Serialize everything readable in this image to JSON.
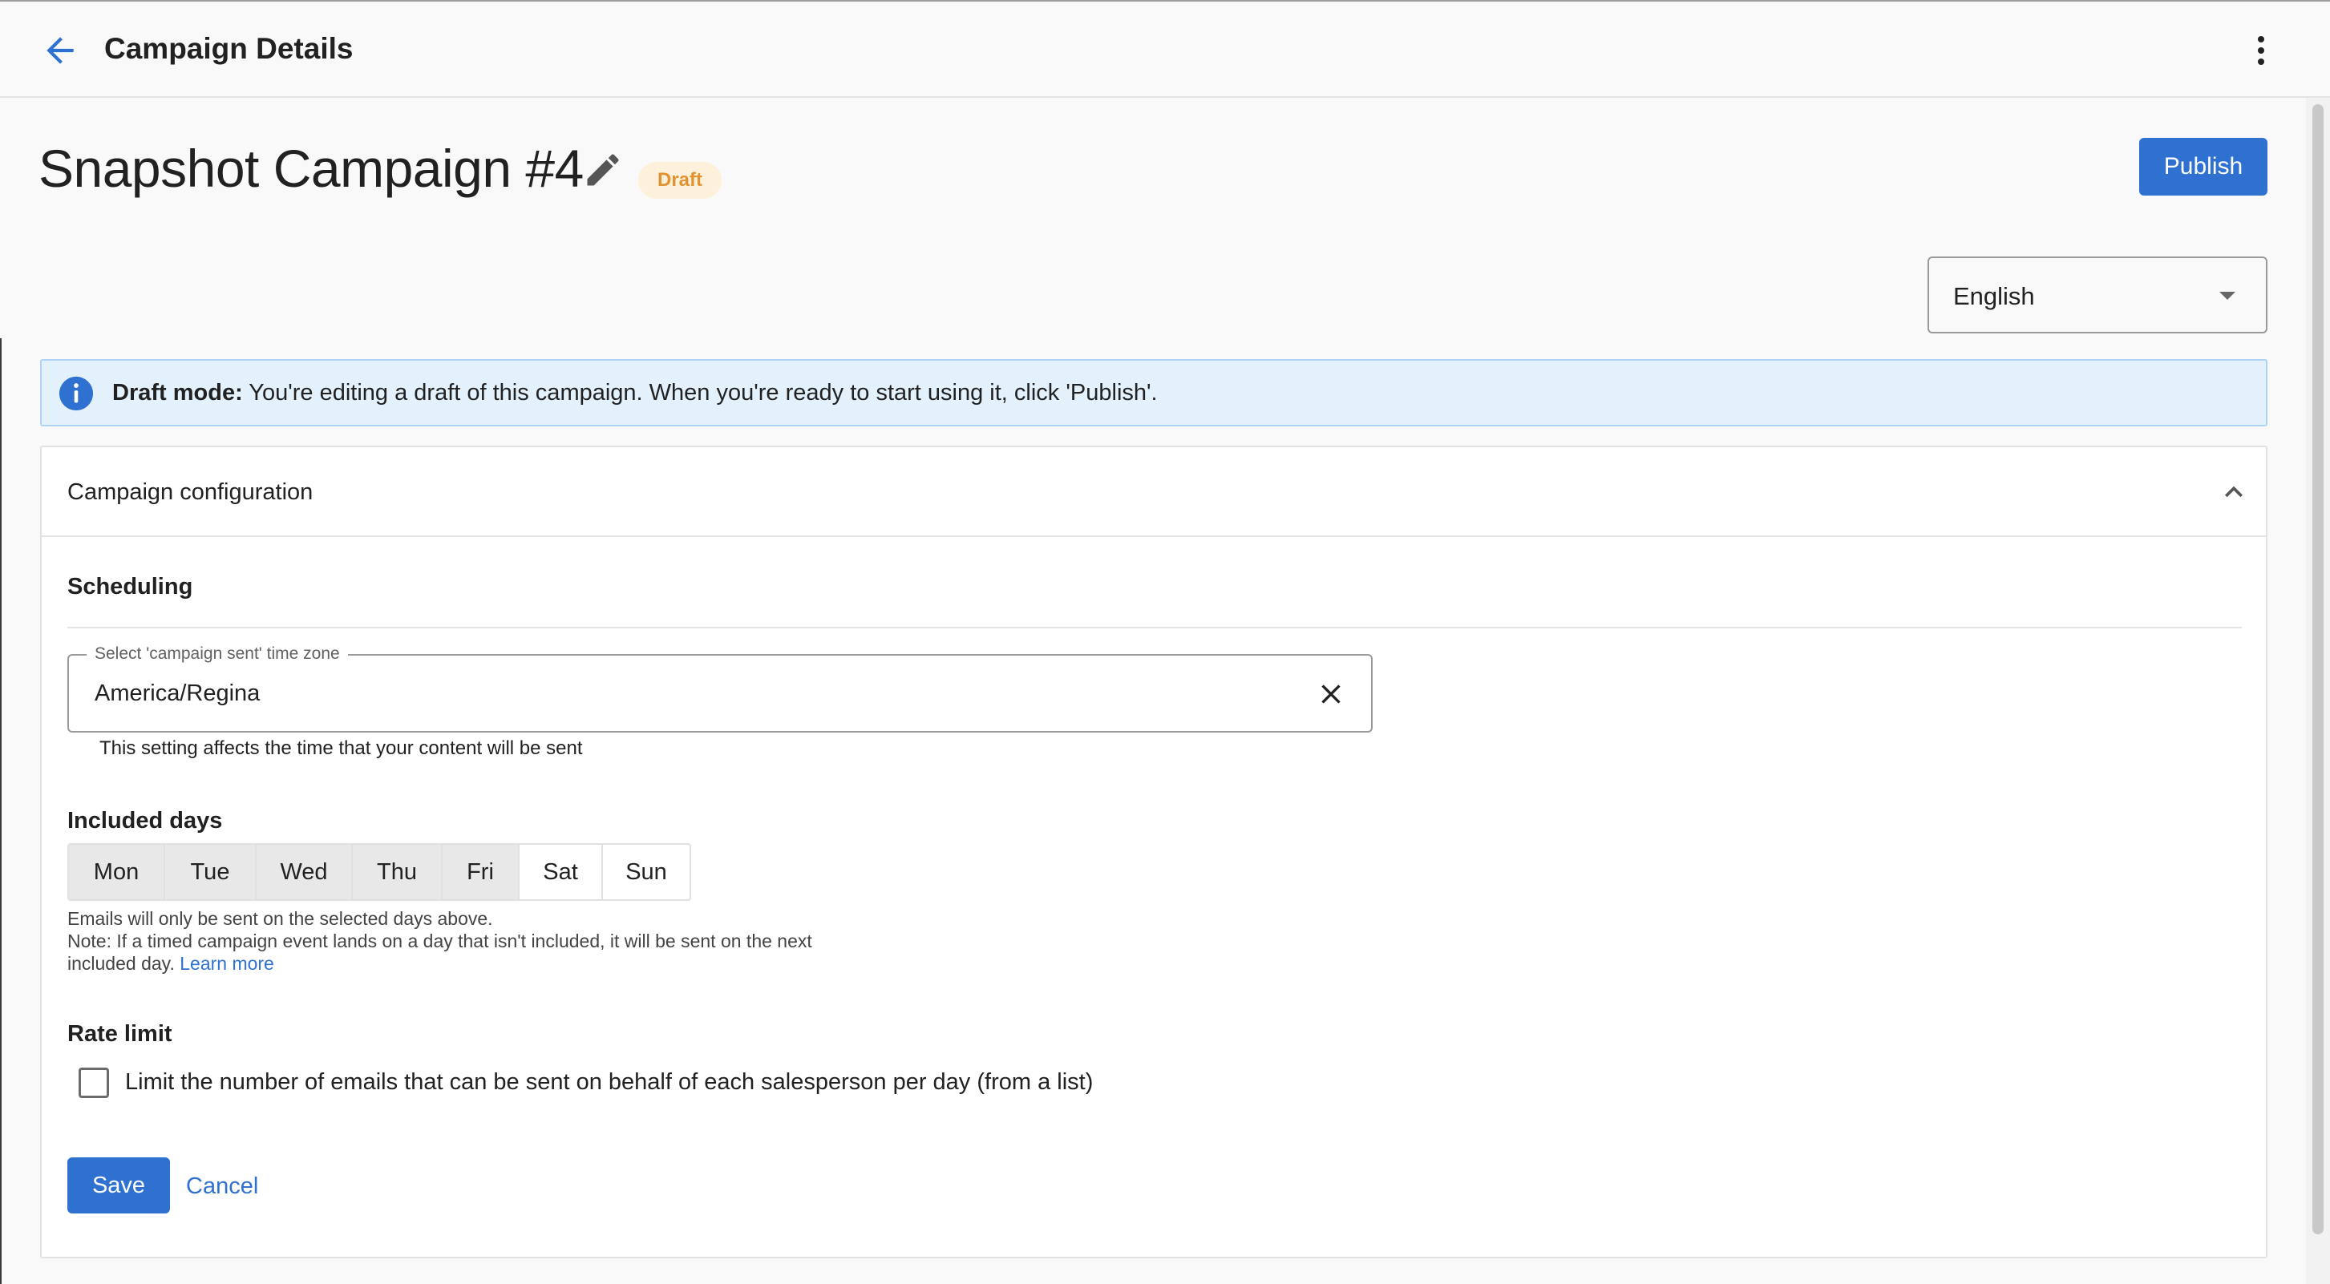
{
  "header": {
    "title": "Campaign Details",
    "back_icon": "arrow-left-icon",
    "more_icon": "more-vertical-icon"
  },
  "campaign": {
    "name": "Snapshot Campaign #4",
    "status": "Draft",
    "publish_label": "Publish",
    "language": "English"
  },
  "banner": {
    "label": "Draft mode:",
    "message": "You're editing a draft of this campaign. When you're ready to start using it, click 'Publish'."
  },
  "config": {
    "title": "Campaign configuration",
    "scheduling": {
      "heading": "Scheduling",
      "timezone_label": "Select 'campaign sent' time zone",
      "timezone_value": "America/Regina",
      "timezone_helper": "This setting affects the time that your content will be sent"
    },
    "included_days": {
      "heading": "Included days",
      "days": [
        {
          "label": "Mon",
          "selected": true
        },
        {
          "label": "Tue",
          "selected": true
        },
        {
          "label": "Wed",
          "selected": true
        },
        {
          "label": "Thu",
          "selected": true
        },
        {
          "label": "Fri",
          "selected": true
        },
        {
          "label": "Sat",
          "selected": false
        },
        {
          "label": "Sun",
          "selected": false
        }
      ],
      "note_line1": "Emails will only be sent on the selected days above.",
      "note_line2": "Note: If a timed campaign event lands on a day that isn't included, it will be sent on the next",
      "note_line3": "included day.",
      "learn_more": "Learn more"
    },
    "rate_limit": {
      "heading": "Rate limit",
      "checkbox_label": "Limit the number of emails that can be sent on behalf of each salesperson per day (from a list)",
      "checked": false
    },
    "save_label": "Save",
    "cancel_label": "Cancel"
  },
  "colors": {
    "accent": "#2f71d1",
    "draft_badge_bg": "#fdf1dc",
    "draft_badge_text": "#e2922f",
    "banner_bg": "#e3f1fd",
    "banner_border": "#aed3f4"
  }
}
